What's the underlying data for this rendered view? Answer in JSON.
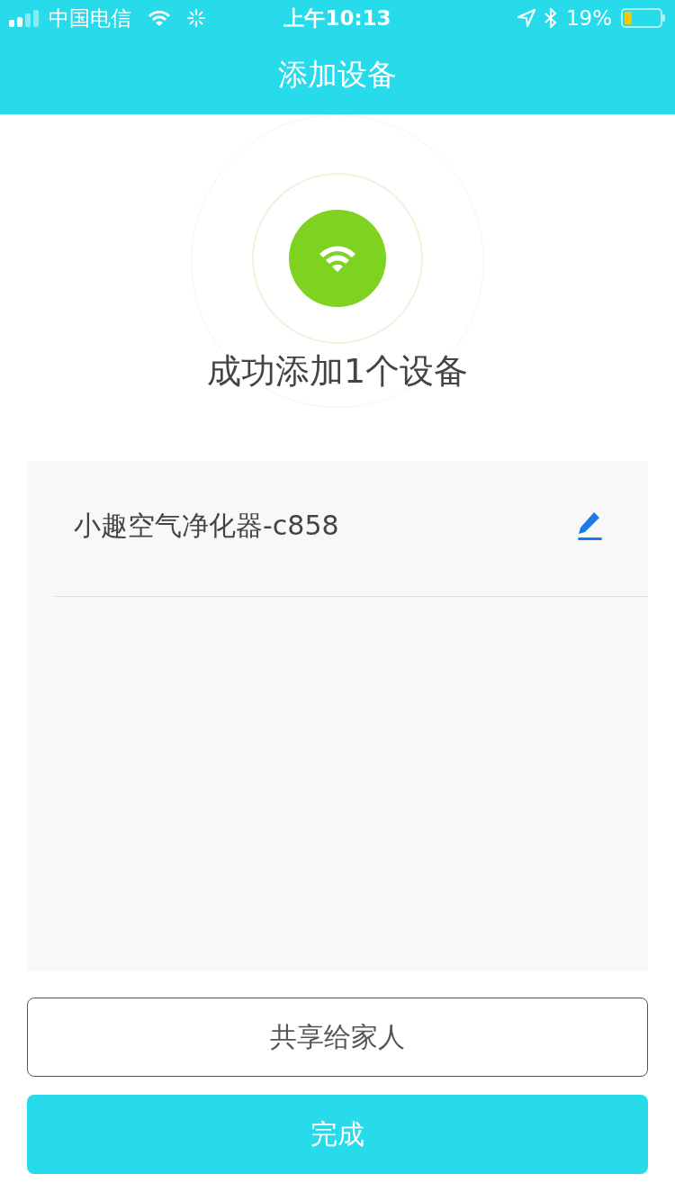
{
  "status_bar": {
    "carrier": "中国电信",
    "time": "上午10:13",
    "battery": "19%"
  },
  "nav_bar": {
    "title": "添加设备"
  },
  "result": {
    "message": "成功添加1个设备"
  },
  "devices": [
    {
      "name": "小趣空气净化器-c858"
    }
  ],
  "buttons": [
    {
      "kind": "outline",
      "label": "共享给家人"
    },
    {
      "kind": "primary",
      "label": "完成"
    }
  ]
}
